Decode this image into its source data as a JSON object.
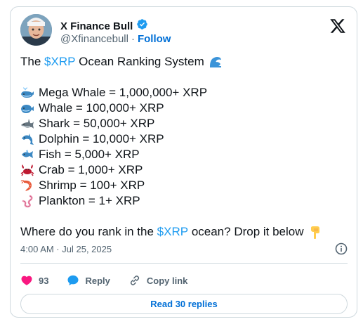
{
  "author": {
    "name": "X Finance Bull",
    "handle": "@Xfinancebull",
    "separator": "·",
    "follow_label": "Follow"
  },
  "tweet": {
    "title_prefix": "The ",
    "title_cashtag": "$XRP",
    "title_suffix": " Ocean Ranking System",
    "ranks": [
      {
        "icon": "whale-spouting-icon",
        "text": "Mega Whale = 1,000,000+ XRP"
      },
      {
        "icon": "whale-icon",
        "text": "Whale = 100,000+ XRP"
      },
      {
        "icon": "shark-icon",
        "text": "Shark = 50,000+ XRP"
      },
      {
        "icon": "dolphin-icon",
        "text": "Dolphin = 10,000+ XRP"
      },
      {
        "icon": "fish-icon",
        "text": "Fish = 5,000+ XRP"
      },
      {
        "icon": "crab-icon",
        "text": "Crab = 1,000+ XRP"
      },
      {
        "icon": "shrimp-icon",
        "text": "Shrimp = 100+ XRP"
      },
      {
        "icon": "worm-icon",
        "text": "Plankton = 1+ XRP"
      }
    ],
    "question_prefix": "Where do you rank in the ",
    "question_cashtag": "$XRP",
    "question_suffix": " ocean? Drop it below"
  },
  "meta": {
    "timestamp": "4:00 AM · Jul 25, 2025"
  },
  "actions": {
    "likes": "93",
    "reply_label": "Reply",
    "copy_link_label": "Copy link"
  },
  "read_replies_label": "Read 30 replies",
  "colors": {
    "link": "#1d9bf0",
    "follow": "#006fd6",
    "like": "#f91880",
    "reply": "#1d9bf0",
    "muted": "#536471",
    "border": "#cfd9de"
  }
}
